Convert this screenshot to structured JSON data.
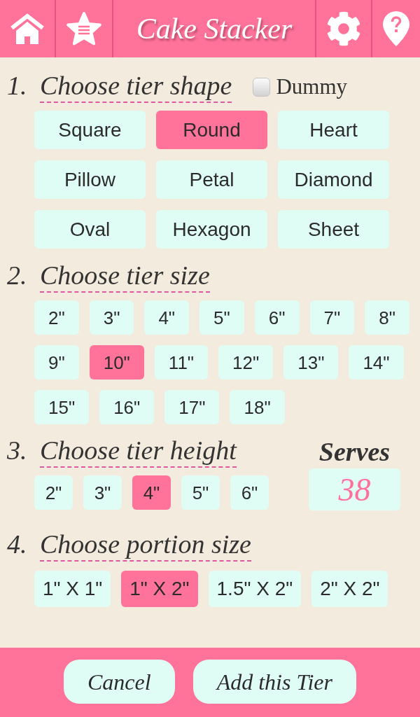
{
  "header": {
    "title": "Cake Stacker"
  },
  "sections": [
    {
      "number": "1.",
      "title": "Choose tier shape",
      "kind": "shape",
      "dummy": {
        "label": "Dummy",
        "checked": false
      },
      "options": [
        {
          "label": "Square",
          "selected": false
        },
        {
          "label": "Round",
          "selected": true
        },
        {
          "label": "Heart",
          "selected": false
        },
        {
          "label": "Pillow",
          "selected": false
        },
        {
          "label": "Petal",
          "selected": false
        },
        {
          "label": "Diamond",
          "selected": false
        },
        {
          "label": "Oval",
          "selected": false
        },
        {
          "label": "Hexagon",
          "selected": false
        },
        {
          "label": "Sheet",
          "selected": false
        }
      ]
    },
    {
      "number": "2.",
      "title": "Choose tier size",
      "kind": "size",
      "options": [
        {
          "label": "2\"",
          "selected": false
        },
        {
          "label": "3\"",
          "selected": false
        },
        {
          "label": "4\"",
          "selected": false
        },
        {
          "label": "5\"",
          "selected": false
        },
        {
          "label": "6\"",
          "selected": false
        },
        {
          "label": "7\"",
          "selected": false
        },
        {
          "label": "8\"",
          "selected": false
        },
        {
          "label": "9\"",
          "selected": false
        },
        {
          "label": "10\"",
          "selected": true
        },
        {
          "label": "11\"",
          "selected": false
        },
        {
          "label": "12\"",
          "selected": false
        },
        {
          "label": "13\"",
          "selected": false
        },
        {
          "label": "14\"",
          "selected": false
        },
        {
          "label": "15\"",
          "selected": false
        },
        {
          "label": "16\"",
          "selected": false
        },
        {
          "label": "17\"",
          "selected": false
        },
        {
          "label": "18\"",
          "selected": false
        }
      ]
    },
    {
      "number": "3.",
      "title": "Choose tier height",
      "kind": "height",
      "serves": {
        "label": "Serves",
        "value": "38"
      },
      "options": [
        {
          "label": "2\"",
          "selected": false
        },
        {
          "label": "3\"",
          "selected": false
        },
        {
          "label": "4\"",
          "selected": true
        },
        {
          "label": "5\"",
          "selected": false
        },
        {
          "label": "6\"",
          "selected": false
        }
      ]
    },
    {
      "number": "4.",
      "title": "Choose portion size",
      "kind": "portion",
      "options": [
        {
          "label": "1\" X 1\"",
          "selected": false
        },
        {
          "label": "1\" X 2\"",
          "selected": true
        },
        {
          "label": "1.5\" X 2\"",
          "selected": false
        },
        {
          "label": "2\" X 2\"",
          "selected": false
        }
      ]
    }
  ],
  "footer": {
    "buttons": [
      {
        "label": "Cancel"
      },
      {
        "label": "Add this Tier"
      }
    ]
  }
}
